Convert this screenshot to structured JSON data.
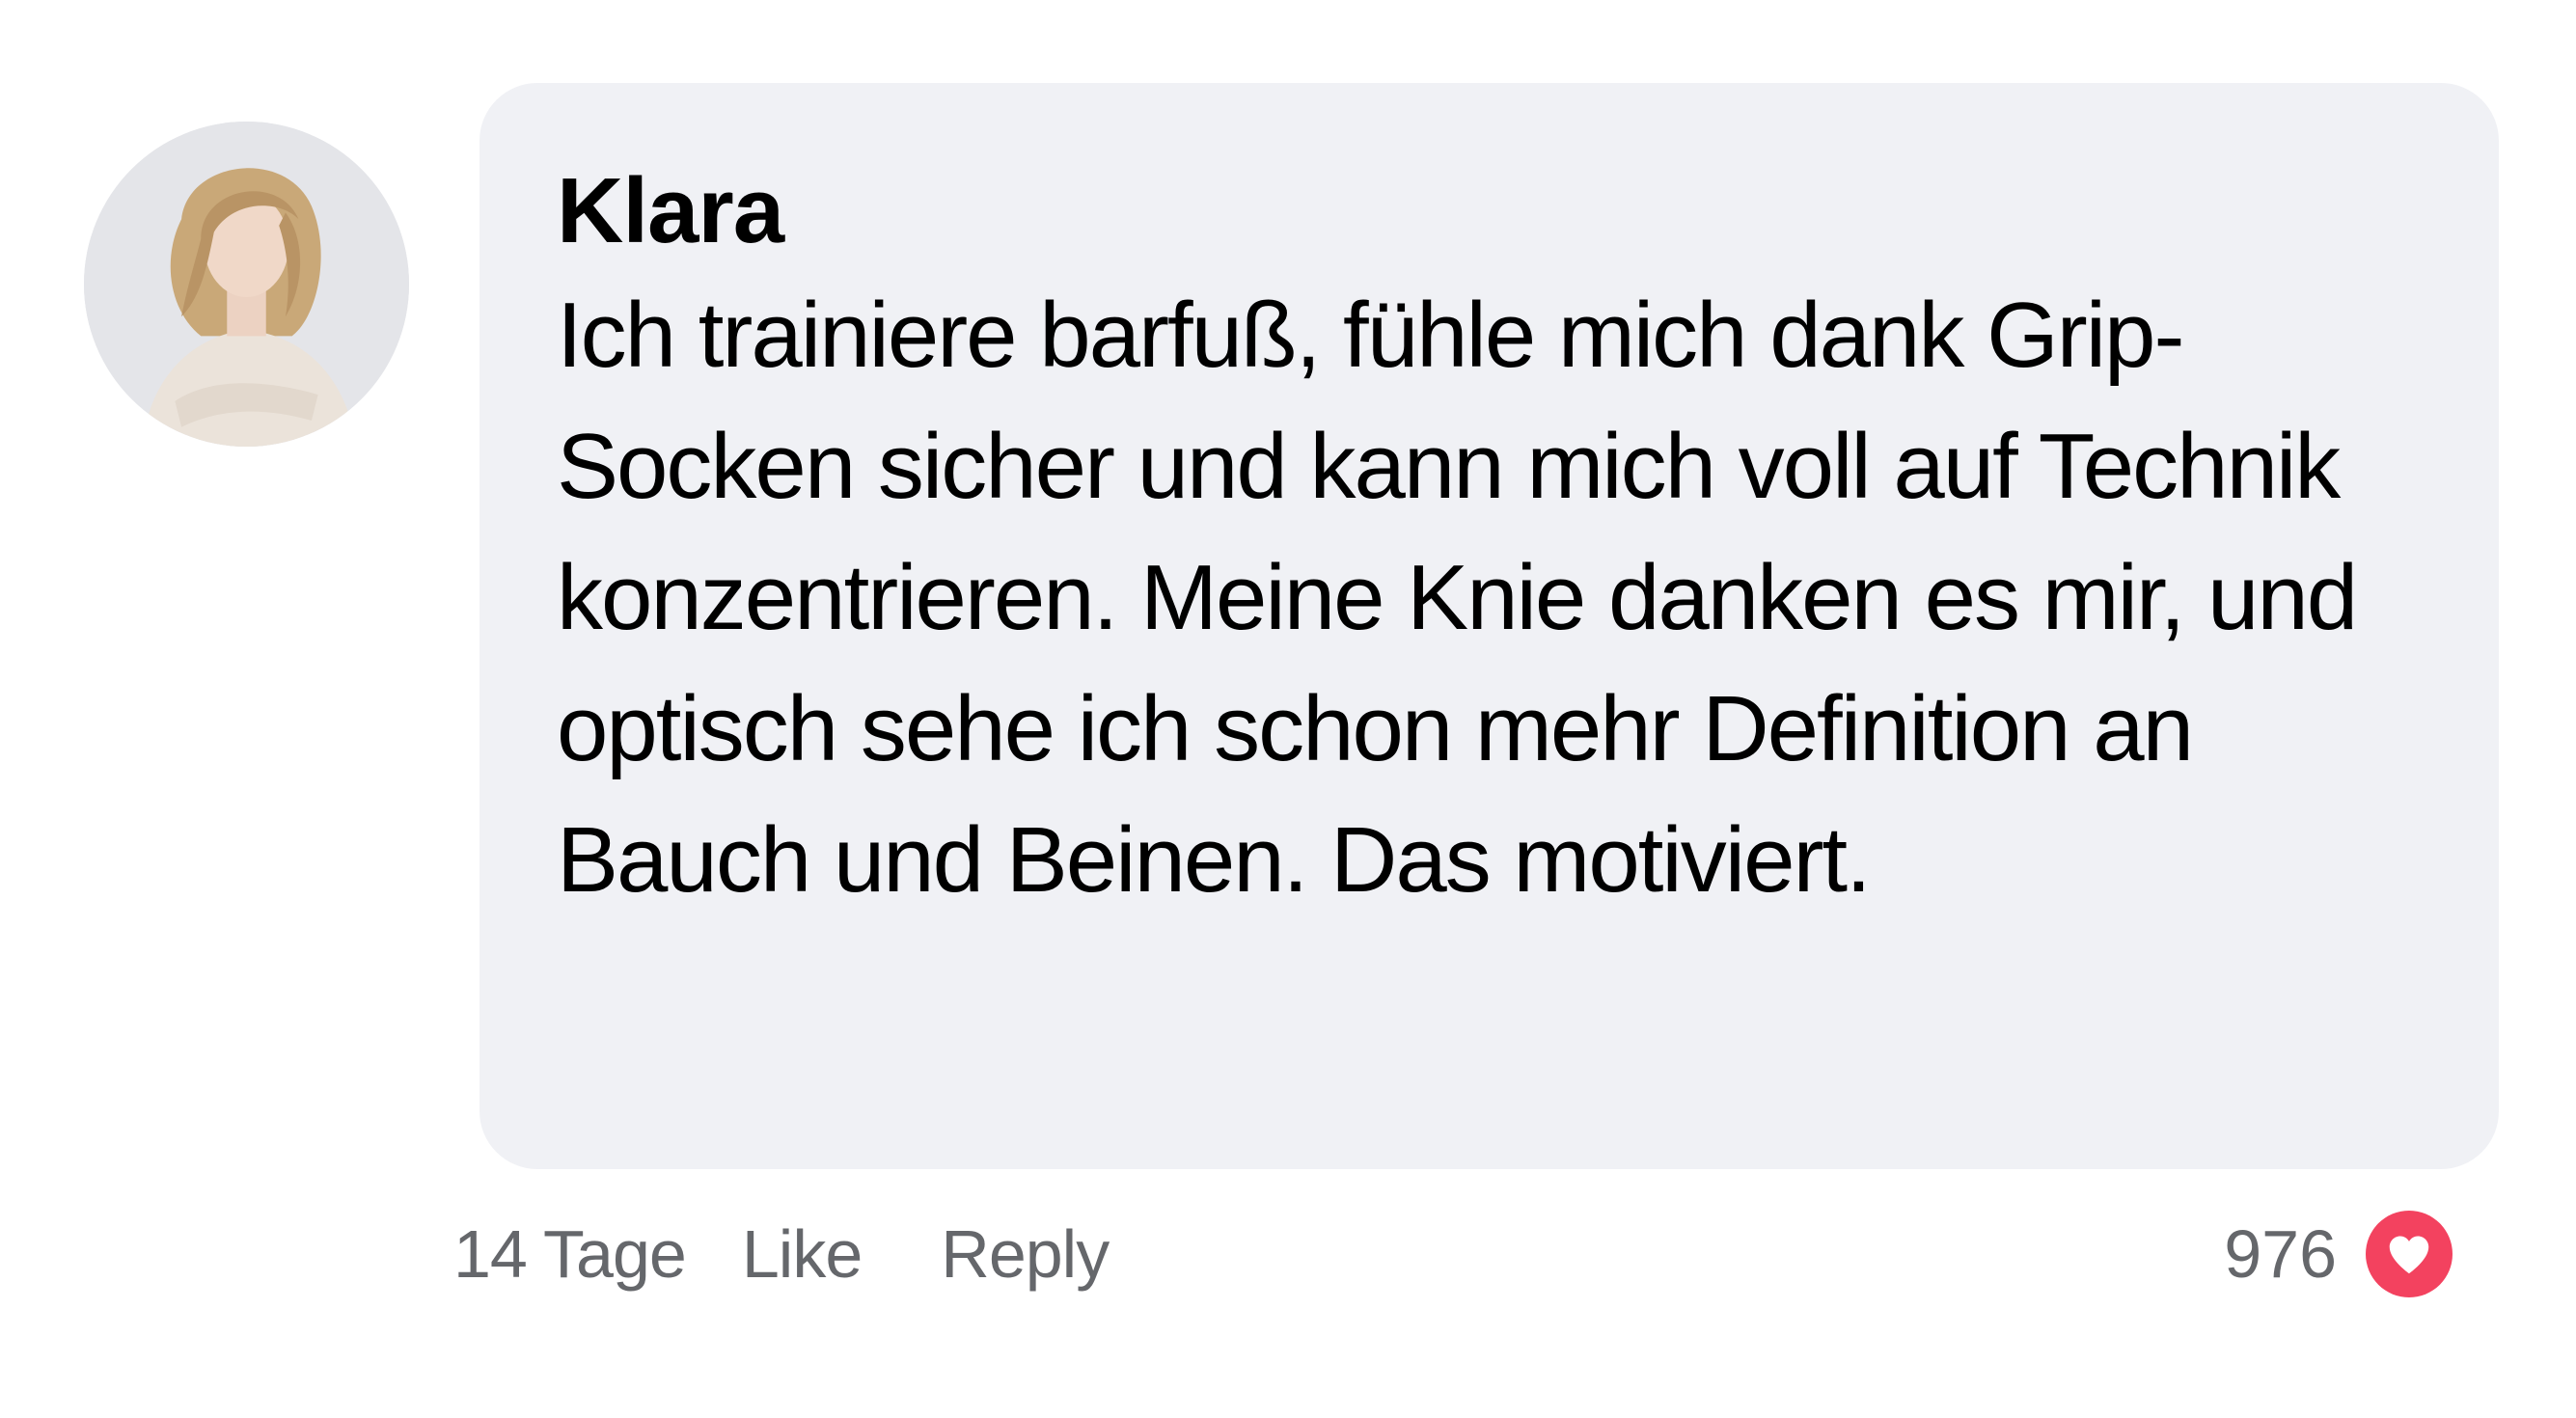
{
  "comment": {
    "author": "Klara",
    "text": "Ich trainiere barfuß, fühle mich dank Grip-Socken sicher und kann mich voll auf Technik konzentrieren. Meine Knie danken es mir, und optisch sehe ich schon mehr Definition an Bauch und Beinen. Das motiviert.",
    "avatar_icon": "user-photo-avatar"
  },
  "actions": {
    "time": "14 Tage",
    "like_label": "Like",
    "reply_label": "Reply"
  },
  "reactions": {
    "count": "976",
    "icon": "heart-icon",
    "color": "#f3425f"
  },
  "colors": {
    "bubble": "#f0f1f5",
    "meta_text": "#65676b"
  }
}
